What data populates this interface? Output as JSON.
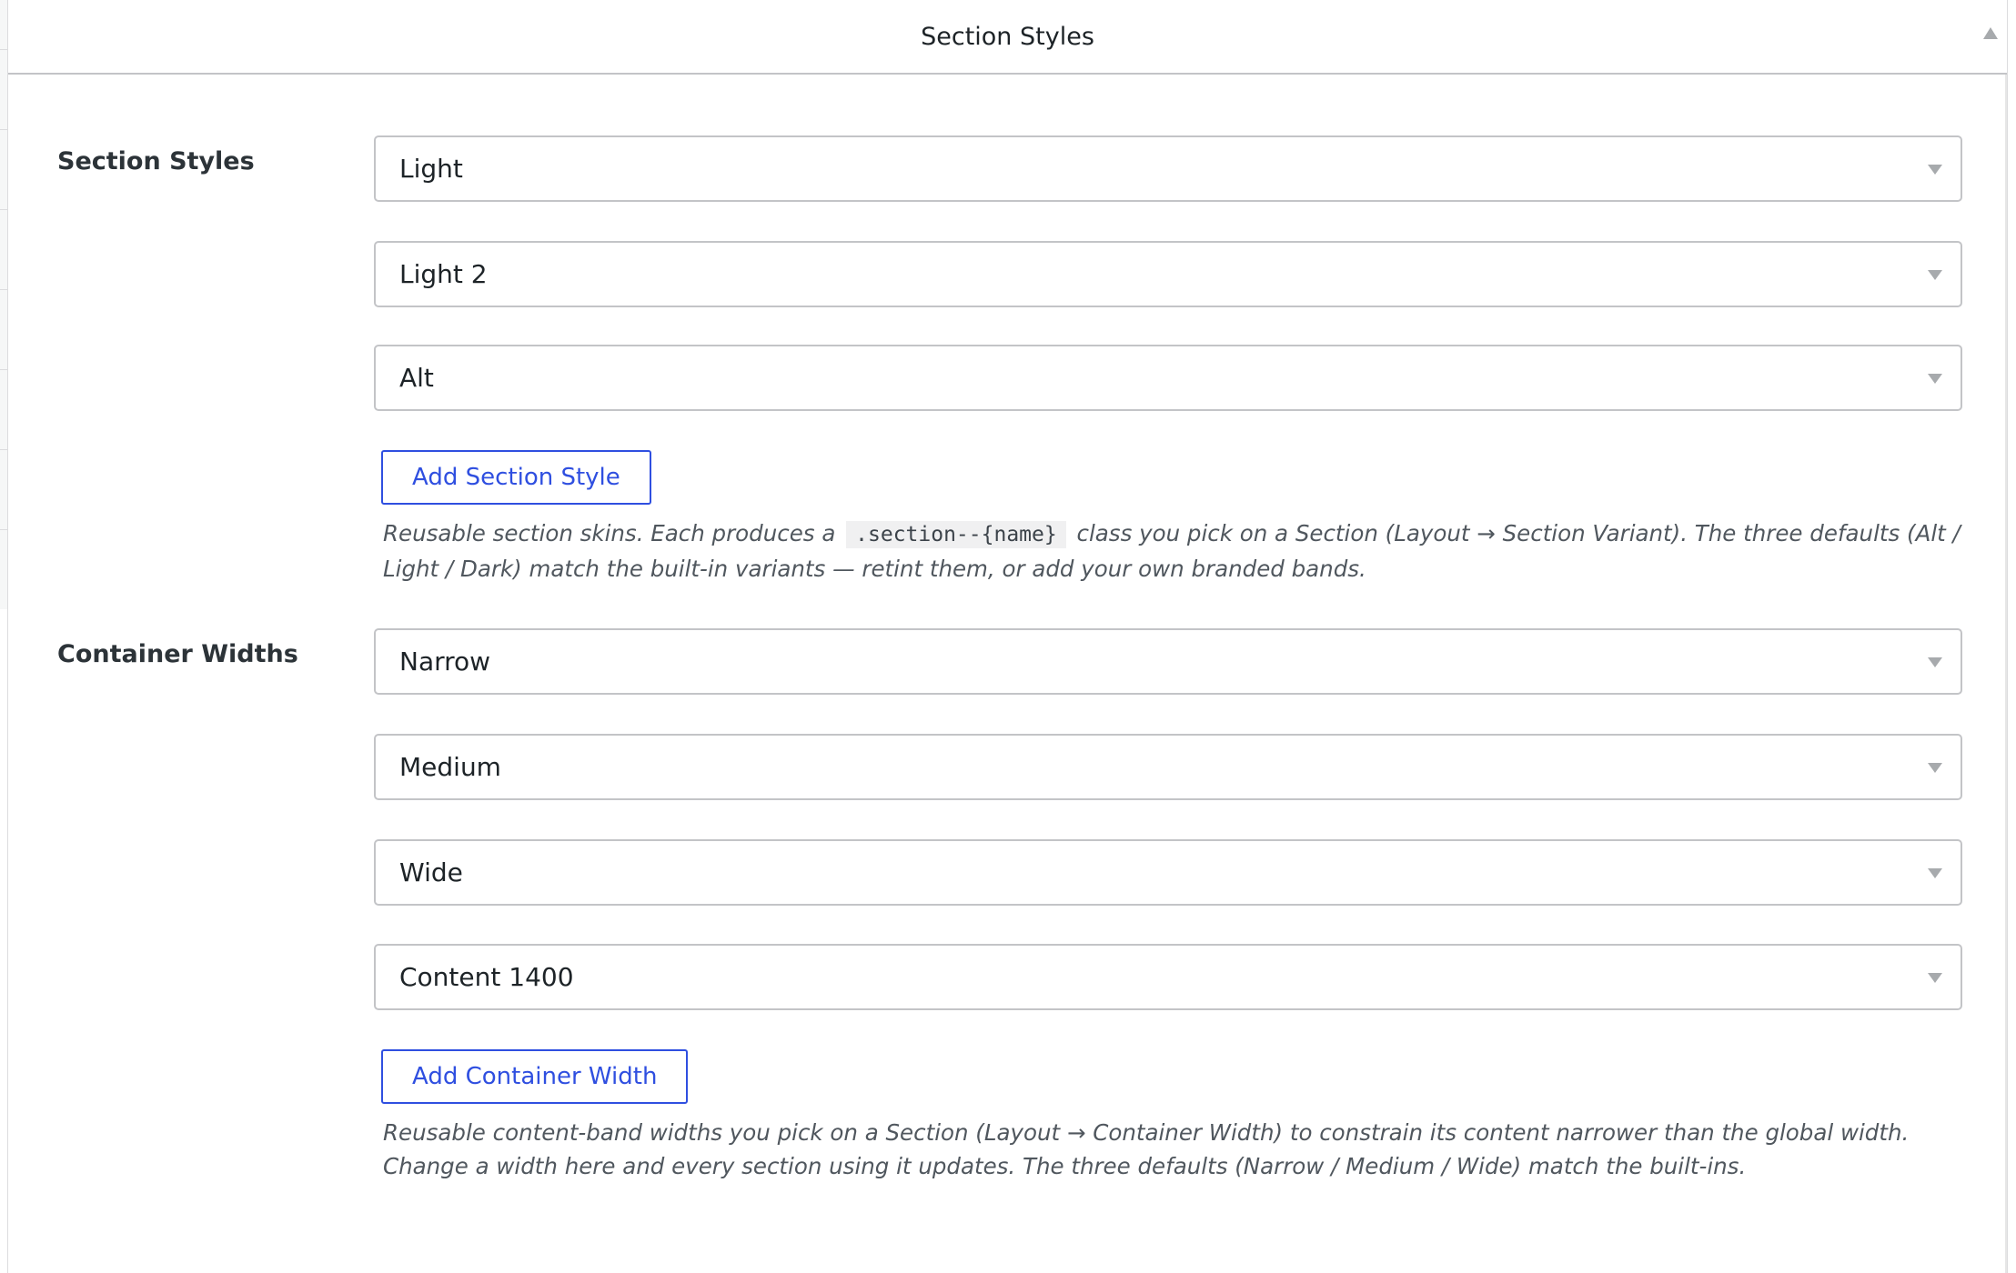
{
  "panel": {
    "title": "Section Styles"
  },
  "section_styles": {
    "label": "Section Styles",
    "items": [
      {
        "value": "Light"
      },
      {
        "value": "Light 2"
      },
      {
        "value": "Alt"
      }
    ],
    "add_button": "Add Section Style",
    "description": {
      "before_code": "Reusable section skins. Each produces a",
      "code": ".section--{name}",
      "after_code": "class you pick on a Section (Layout → Section Variant). The three defaults (Alt / Light / Dark) match the built-in variants — retint them, or add your own branded bands."
    }
  },
  "container_widths": {
    "label": "Container Widths",
    "items": [
      {
        "value": "Narrow"
      },
      {
        "value": "Medium"
      },
      {
        "value": "Wide"
      },
      {
        "value": "Content 1400"
      }
    ],
    "add_button": "Add Container Width",
    "description": "Reusable content-band widths you pick on a Section (Layout → Container Width) to constrain its content narrower than the global width. Change a width here and every section using it updates. The three defaults (Narrow / Medium / Wide) match the built-ins."
  },
  "colors": {
    "accent": "#2f4fe0",
    "border": "#c3c4c7",
    "text": "#1d2327",
    "muted": "#50575e"
  },
  "icons": {
    "collapse": "triangle-up-icon",
    "select_caret": "triangle-down-icon"
  }
}
